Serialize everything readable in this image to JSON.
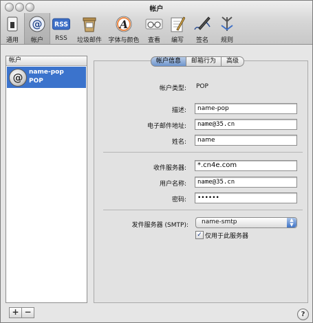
{
  "window": {
    "title": "帐户"
  },
  "toolbar": {
    "items": [
      {
        "label": "通用",
        "icon": "switch-icon"
      },
      {
        "label": "帐户",
        "icon": "at-sign-icon",
        "active": true
      },
      {
        "label": "RSS",
        "icon": "rss-icon"
      },
      {
        "label": "垃圾邮件",
        "icon": "junk-mail-icon"
      },
      {
        "label": "字体与颜色",
        "icon": "font-icon"
      },
      {
        "label": "查看",
        "icon": "glasses-icon"
      },
      {
        "label": "编写",
        "icon": "compose-icon"
      },
      {
        "label": "签名",
        "icon": "signature-icon"
      },
      {
        "label": "规则",
        "icon": "rules-icon"
      }
    ],
    "rss_icon_text": "RSS",
    "font_icon_text": "A"
  },
  "sidebar": {
    "header": "帐户",
    "accounts": [
      {
        "name": "name-pop",
        "type": "POP"
      }
    ],
    "add_label": "+",
    "remove_label": "−"
  },
  "tabs": [
    "帐户信息",
    "邮箱行为",
    "高级"
  ],
  "account_info": {
    "account_type_label": "帐户类型:",
    "account_type_value": "POP",
    "description_label": "描述:",
    "description_value": "name-pop",
    "email_label": "电子邮件地址:",
    "email_value": "name@35.cn",
    "fullname_label": "姓名:",
    "fullname_value": "name",
    "incoming_server_label": "收件服务器:",
    "incoming_server_value": "*.cn4e.com",
    "username_label": "用户名称:",
    "username_value": "name@35.cn",
    "password_label": "密码:",
    "password_value": "••••••",
    "smtp_label": "发件服务器 (SMTP):",
    "smtp_value": "name-smtp",
    "only_this_server_label": "仅用于此服务器",
    "only_this_server_checked": true
  },
  "help_label": "?"
}
